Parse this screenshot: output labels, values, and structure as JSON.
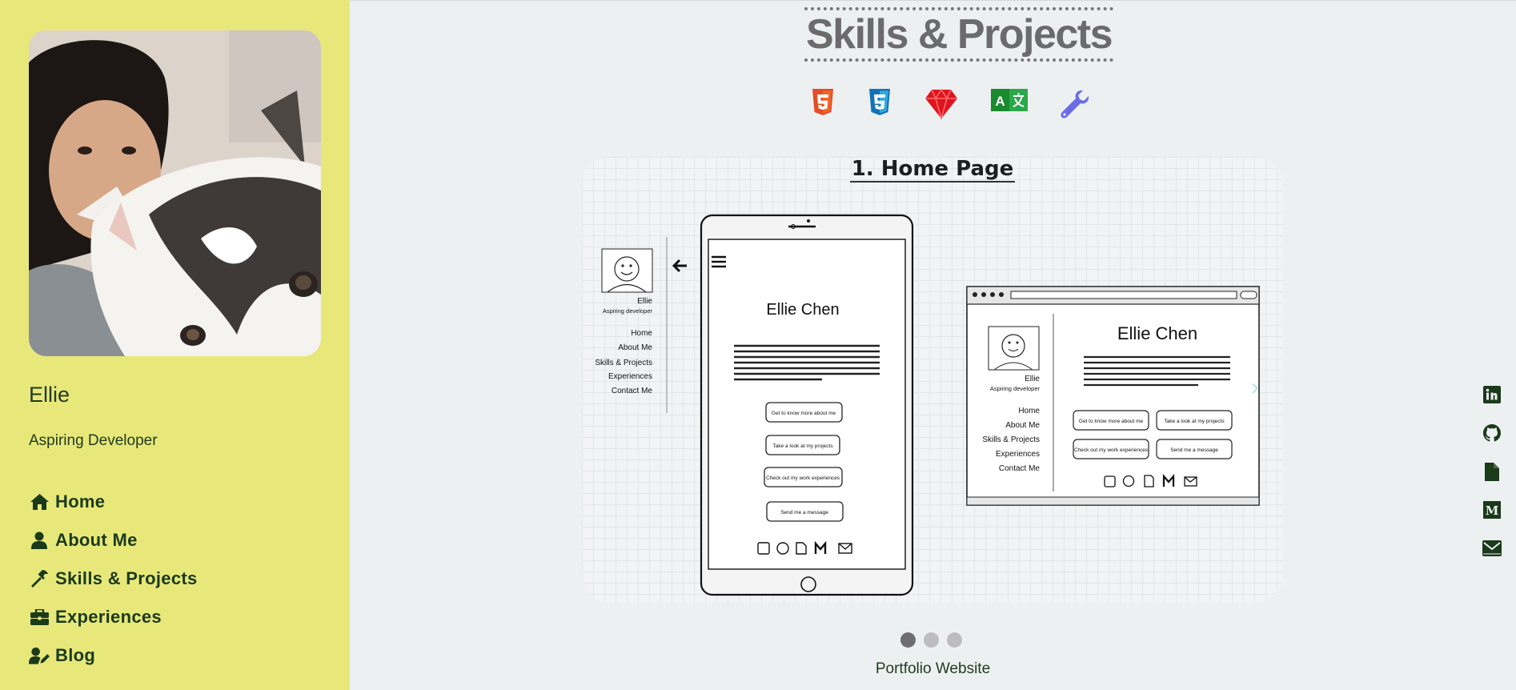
{
  "sidebar": {
    "name": "Ellie",
    "role": "Aspiring Developer",
    "nav": [
      {
        "label": "Home",
        "icon": "home-icon"
      },
      {
        "label": "About Me",
        "icon": "user-icon"
      },
      {
        "label": "Skills & Projects",
        "icon": "hammer-icon"
      },
      {
        "label": "Experiences",
        "icon": "briefcase-icon"
      },
      {
        "label": "Blog",
        "icon": "user-edit-icon"
      }
    ]
  },
  "main": {
    "title": "Skills & Projects",
    "skills": [
      "html5-icon",
      "css3-icon",
      "ruby-icon",
      "translate-icon",
      "wrench-icon"
    ],
    "slide": {
      "title": "1. Home Page",
      "caption": "Portfolio Website",
      "wireframe": {
        "side_name": "Ellie",
        "side_role": "Aspiring developer",
        "side_links": [
          "Home",
          "About Me",
          "Skills & Projects",
          "Experiences",
          "Contact Me"
        ],
        "heading": "Ellie Chen",
        "buttons": [
          "Get to know more about me",
          "Take a look at my projects",
          "Check out my work experiences",
          "Send me a message"
        ]
      }
    },
    "dots": 3,
    "active_dot": 1
  },
  "social": [
    "linkedin-icon",
    "github-icon",
    "resume-file-icon",
    "medium-icon",
    "email-icon"
  ],
  "colors": {
    "sidebar_bg": "#e8e87a",
    "main_bg": "#edf0f1",
    "nav_text": "#1a3a1a",
    "title_text": "#6b6b6b",
    "html5": "#e44d26",
    "css3": "#2965f1",
    "ruby": "#e0141e",
    "translate": "#1a8a2e",
    "wrench": "#6a6de3"
  }
}
